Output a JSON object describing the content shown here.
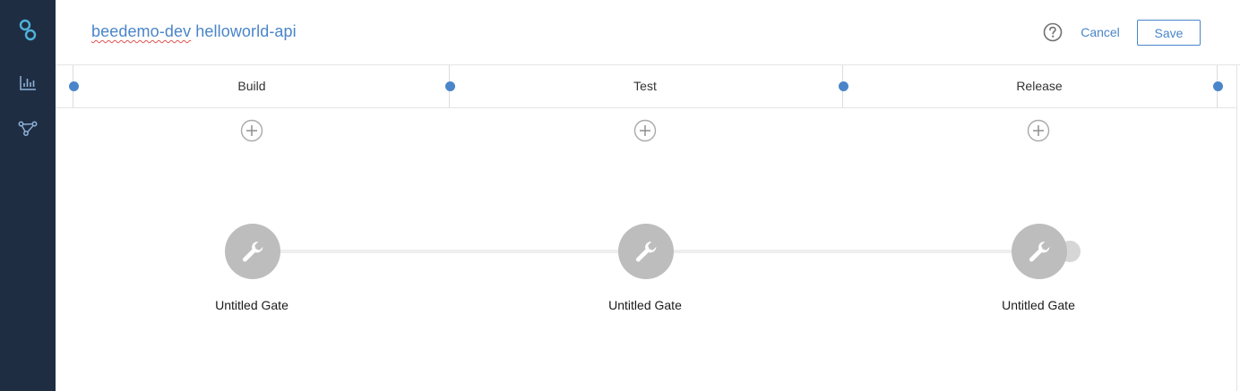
{
  "header": {
    "title_org": "beedemo-dev",
    "title_name": "helloworld-api",
    "cancel_label": "Cancel",
    "save_label": "Save"
  },
  "stages": [
    {
      "label": "Build"
    },
    {
      "label": "Test"
    },
    {
      "label": "Release"
    }
  ],
  "gates": [
    {
      "label": "Untitled Gate",
      "icon": "wrench-icon"
    },
    {
      "label": "Untitled Gate",
      "icon": "wrench-icon"
    },
    {
      "label": "Untitled Gate",
      "icon": "wrench-icon"
    }
  ],
  "sidebar": {
    "items": [
      {
        "icon": "logo-icon"
      },
      {
        "icon": "bar-chart-icon"
      },
      {
        "icon": "pipeline-icon"
      }
    ]
  },
  "colors": {
    "sidebar_bg": "#1f2d43",
    "accent": "#4a85c9",
    "logo": "#4fb3d9",
    "gate": "#bdbdbd"
  }
}
